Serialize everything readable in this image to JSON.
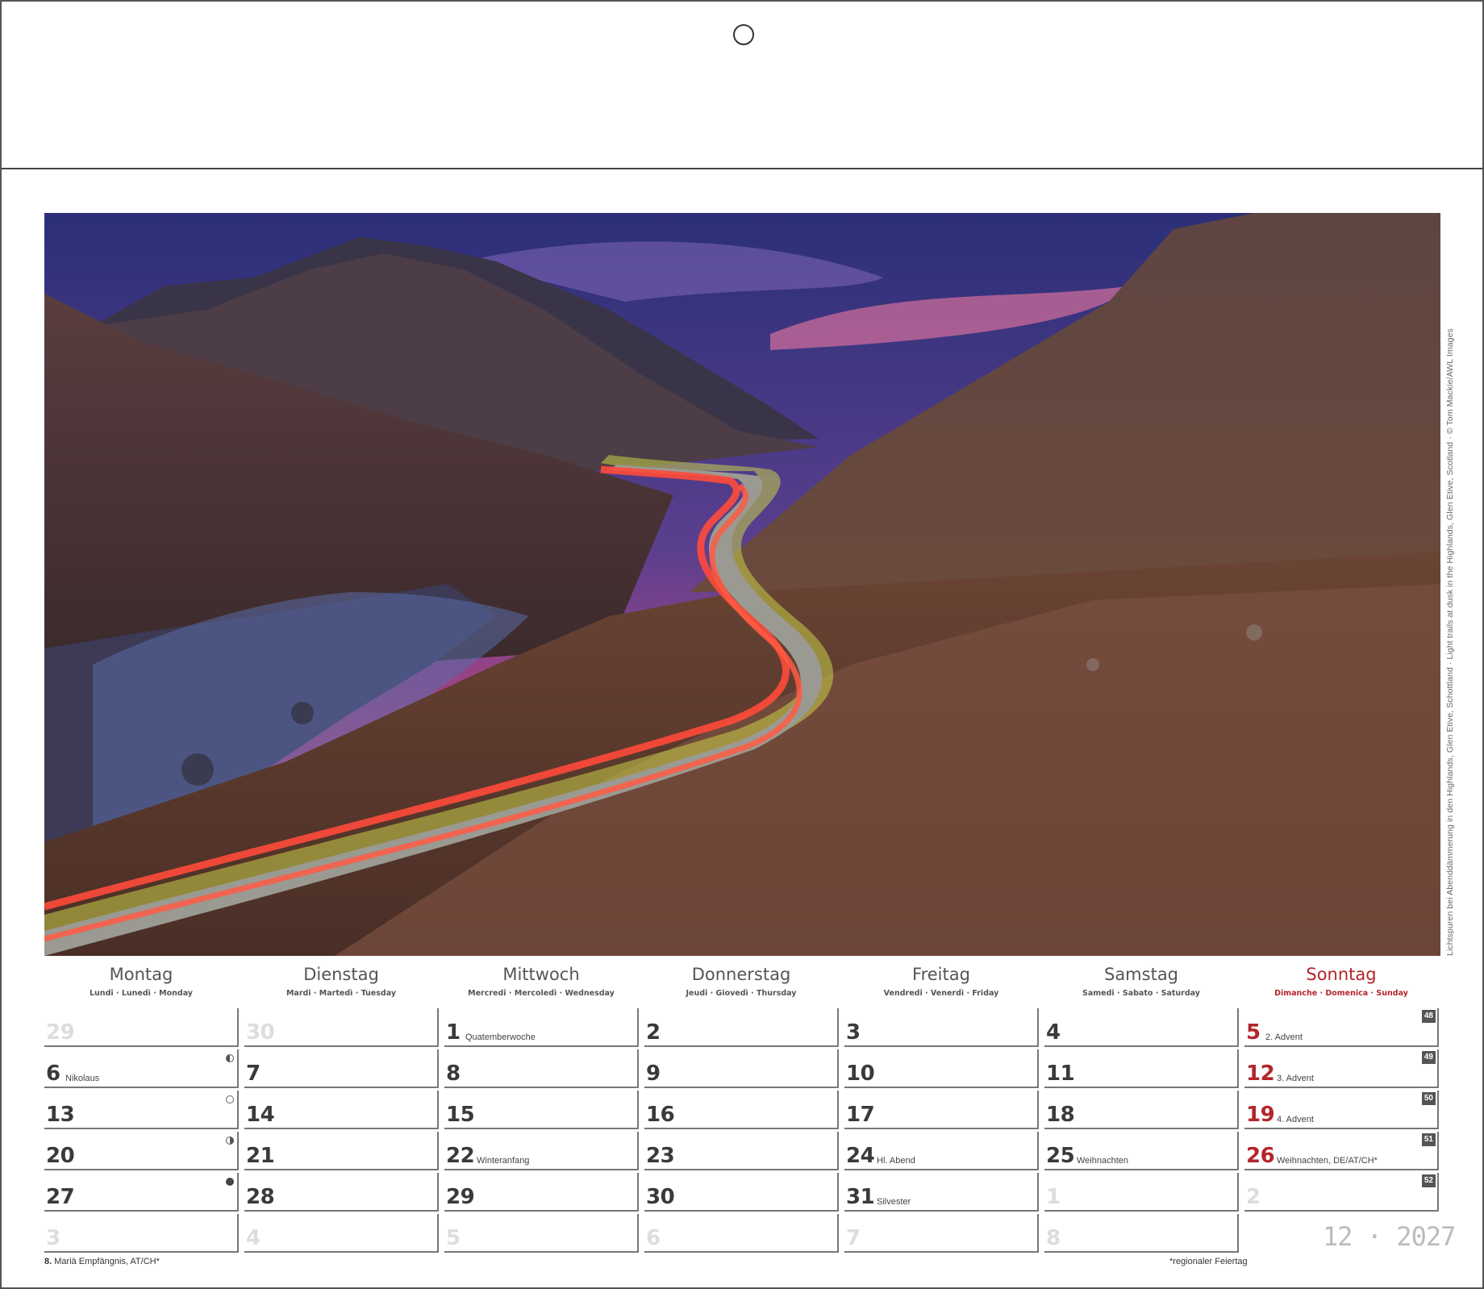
{
  "photo_caption": "Lichtspuren bei Abenddämmerung in den Highlands, Glen Etive, Schottland · Light trails at dusk in the Highlands, Glen Etive, Scotland · © Tom Mackie/AWL Images",
  "weekdays": [
    {
      "name": "Montag",
      "sub": "Lundi · Lunedì · Monday"
    },
    {
      "name": "Dienstag",
      "sub": "Mardi · Martedì · Tuesday"
    },
    {
      "name": "Mittwoch",
      "sub": "Mercredi · Mercoledì · Wednesday"
    },
    {
      "name": "Donnerstag",
      "sub": "Jeudi · Giovedì · Thursday"
    },
    {
      "name": "Freitag",
      "sub": "Vendredi · Venerdì · Friday"
    },
    {
      "name": "Samstag",
      "sub": "Samedi · Sabato · Saturday"
    },
    {
      "name": "Sonntag",
      "sub": "Dimanche · Domenica · Sunday"
    }
  ],
  "weeks": [
    {
      "kw": "48",
      "days": [
        {
          "n": "29",
          "faded": true
        },
        {
          "n": "30",
          "faded": true
        },
        {
          "n": "1",
          "note": "Quatemberwoche"
        },
        {
          "n": "2"
        },
        {
          "n": "3"
        },
        {
          "n": "4"
        },
        {
          "n": "5",
          "note": "2. Advent",
          "red": true
        }
      ]
    },
    {
      "kw": "49",
      "days": [
        {
          "n": "6",
          "note": "Nikolaus",
          "moon": "half-l"
        },
        {
          "n": "7"
        },
        {
          "n": "8"
        },
        {
          "n": "9"
        },
        {
          "n": "10"
        },
        {
          "n": "11"
        },
        {
          "n": "12",
          "note": "3. Advent",
          "red": true
        }
      ]
    },
    {
      "kw": "50",
      "days": [
        {
          "n": "13",
          "moon": "full"
        },
        {
          "n": "14"
        },
        {
          "n": "15"
        },
        {
          "n": "16"
        },
        {
          "n": "17"
        },
        {
          "n": "18"
        },
        {
          "n": "19",
          "note": "4. Advent",
          "red": true
        }
      ]
    },
    {
      "kw": "51",
      "days": [
        {
          "n": "20",
          "moon": "half-r"
        },
        {
          "n": "21"
        },
        {
          "n": "22",
          "note": "Winteranfang"
        },
        {
          "n": "23"
        },
        {
          "n": "24",
          "note": "Hl. Abend"
        },
        {
          "n": "25",
          "note": "Weihnachten"
        },
        {
          "n": "26",
          "note": "Weihnachten, DE/AT/CH*",
          "red": true
        }
      ]
    },
    {
      "kw": "52",
      "days": [
        {
          "n": "27",
          "moon": "new"
        },
        {
          "n": "28"
        },
        {
          "n": "29"
        },
        {
          "n": "30"
        },
        {
          "n": "31",
          "note": "Silvester"
        },
        {
          "n": "1",
          "faded": true
        },
        {
          "n": "2",
          "faded": true
        }
      ]
    },
    {
      "kw": "",
      "days": [
        {
          "n": "3",
          "faded": true
        },
        {
          "n": "4",
          "faded": true
        },
        {
          "n": "5",
          "faded": true
        },
        {
          "n": "6",
          "faded": true
        },
        {
          "n": "7",
          "faded": true
        },
        {
          "n": "8",
          "faded": true
        }
      ]
    }
  ],
  "footer": {
    "holiday_num": "8.",
    "holiday_text": " Mariä Empfängnis, AT/CH*",
    "regional_note": "*regionaler Feiertag",
    "month_year": "12 · 2027"
  }
}
